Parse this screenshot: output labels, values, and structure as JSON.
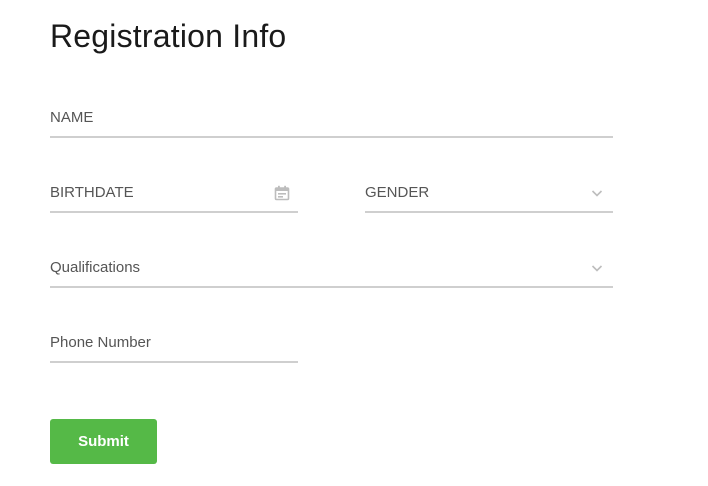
{
  "page": {
    "title": "Registration Info"
  },
  "form": {
    "name": {
      "label": "NAME"
    },
    "birthdate": {
      "label": "BIRTHDATE",
      "icon": "calendar-icon"
    },
    "gender": {
      "label": "GENDER",
      "icon": "chevron-down-icon"
    },
    "qualifications": {
      "label": "Qualifications",
      "icon": "chevron-down-icon"
    },
    "phone": {
      "label": "Phone Number"
    },
    "submit_label": "Submit"
  },
  "colors": {
    "accent": "#55b947",
    "field_underline": "#cfcfcf",
    "label_text": "#555555",
    "title_text": "#1a1a1a",
    "icon": "#bdbdbd"
  }
}
